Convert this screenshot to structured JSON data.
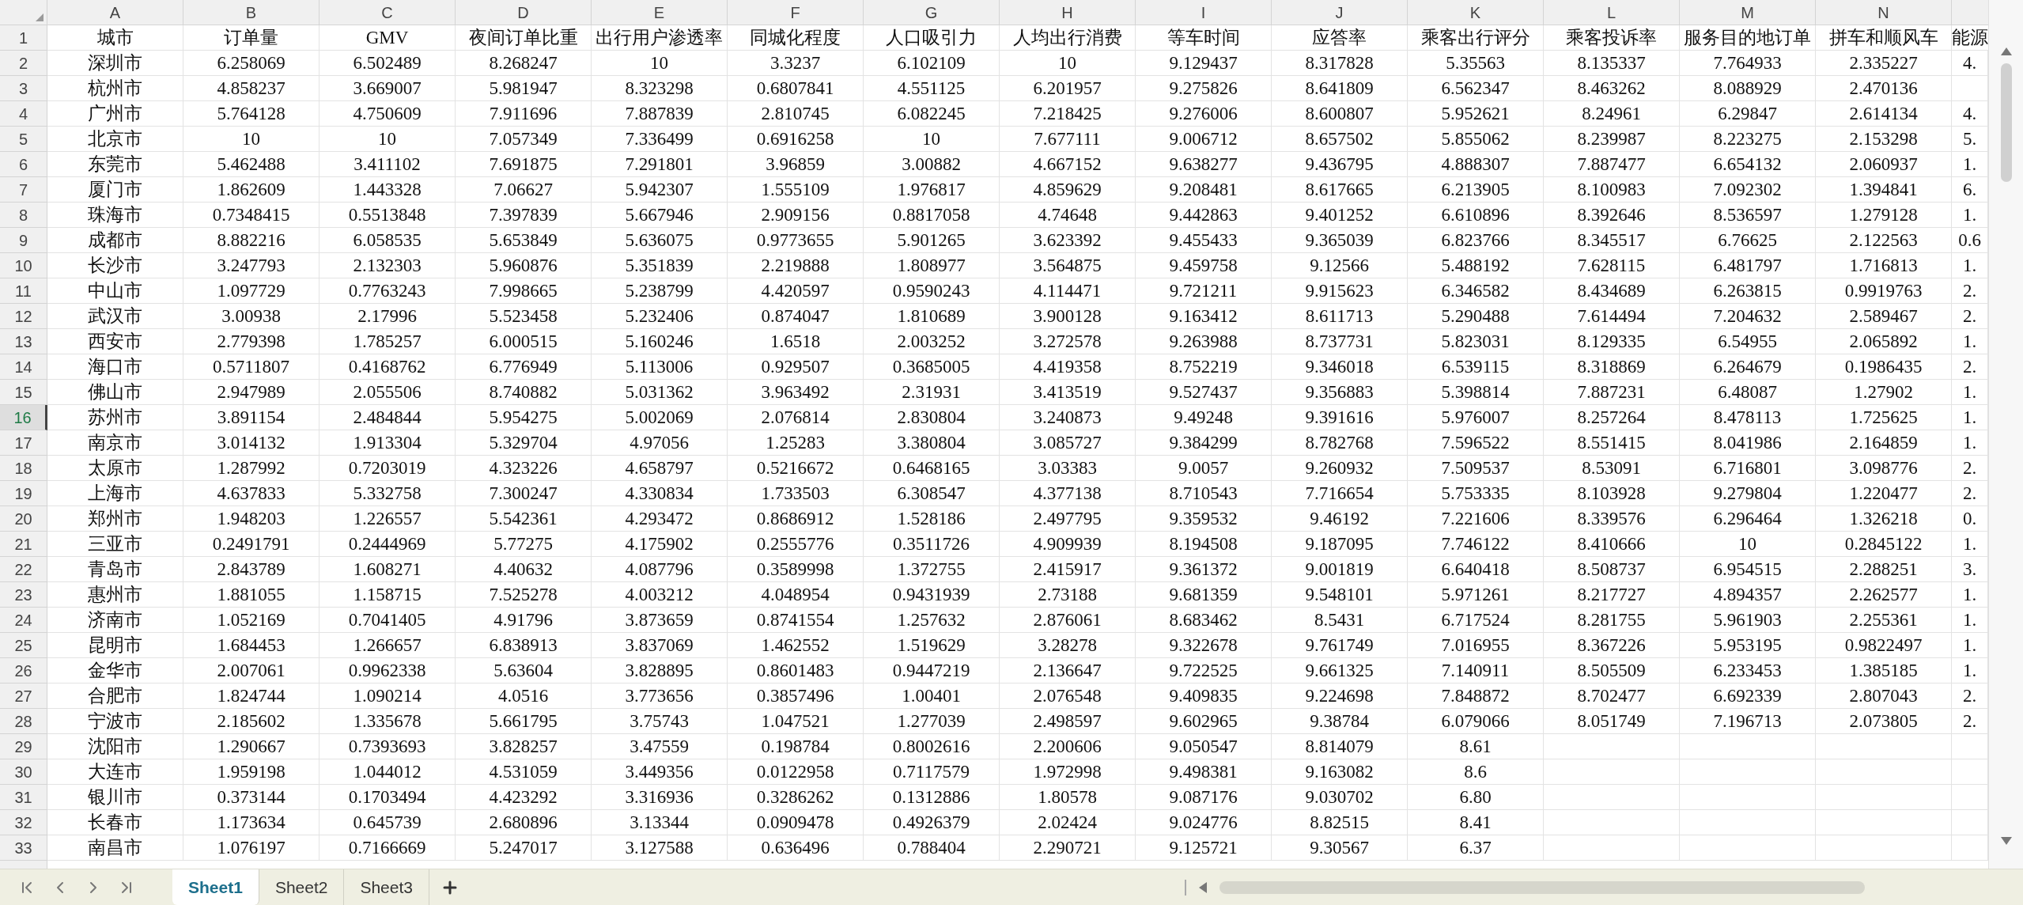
{
  "column_letters": [
    "A",
    "B",
    "C",
    "D",
    "E",
    "F",
    "G",
    "H",
    "I",
    "J",
    "K",
    "L",
    "M",
    "N"
  ],
  "rows": [
    {
      "number": "1",
      "selected": false,
      "cells": [
        "城市",
        "订单量",
        "GMV",
        "夜间订单比重",
        "出行用户渗透率",
        "同城化程度",
        "人口吸引力",
        "人均出行消费",
        "等车时间",
        "应答率",
        "乘客出行评分",
        "乘客投诉率",
        "服务目的地订单",
        "拼车和顺风车",
        "能源"
      ]
    },
    {
      "number": "2",
      "selected": false,
      "cells": [
        "深圳市",
        "6.258069",
        "6.502489",
        "8.268247",
        "10",
        "3.3237",
        "6.102109",
        "10",
        "9.129437",
        "8.317828",
        "5.35563",
        "8.135337",
        "7.764933",
        "2.335227",
        "4."
      ]
    },
    {
      "number": "3",
      "selected": false,
      "cells": [
        "杭州市",
        "4.858237",
        "3.669007",
        "5.981947",
        "8.323298",
        "0.6807841",
        "4.551125",
        "6.201957",
        "9.275826",
        "8.641809",
        "6.562347",
        "8.463262",
        "8.088929",
        "2.470136",
        null
      ]
    },
    {
      "number": "4",
      "selected": false,
      "cells": [
        "广州市",
        "5.764128",
        "4.750609",
        "7.911696",
        "7.887839",
        "2.810745",
        "6.082245",
        "7.218425",
        "9.276006",
        "8.600807",
        "5.952621",
        "8.24961",
        "6.29847",
        "2.614134",
        "4."
      ]
    },
    {
      "number": "5",
      "selected": false,
      "cells": [
        "北京市",
        "10",
        "10",
        "7.057349",
        "7.336499",
        "0.6916258",
        "10",
        "7.677111",
        "9.006712",
        "8.657502",
        "5.855062",
        "8.239987",
        "8.223275",
        "2.153298",
        "5."
      ]
    },
    {
      "number": "6",
      "selected": false,
      "cells": [
        "东莞市",
        "5.462488",
        "3.411102",
        "7.691875",
        "7.291801",
        "3.96859",
        "3.00882",
        "4.667152",
        "9.638277",
        "9.436795",
        "4.888307",
        "7.887477",
        "6.654132",
        "2.060937",
        "1."
      ]
    },
    {
      "number": "7",
      "selected": false,
      "cells": [
        "厦门市",
        "1.862609",
        "1.443328",
        "7.06627",
        "5.942307",
        "1.555109",
        "1.976817",
        "4.859629",
        "9.208481",
        "8.617665",
        "6.213905",
        "8.100983",
        "7.092302",
        "1.394841",
        "6."
      ]
    },
    {
      "number": "8",
      "selected": false,
      "cells": [
        "珠海市",
        "0.7348415",
        "0.5513848",
        "7.397839",
        "5.667946",
        "2.909156",
        "0.8817058",
        "4.74648",
        "9.442863",
        "9.401252",
        "6.610896",
        "8.392646",
        "8.536597",
        "1.279128",
        "1."
      ]
    },
    {
      "number": "9",
      "selected": false,
      "cells": [
        "成都市",
        "8.882216",
        "6.058535",
        "5.653849",
        "5.636075",
        "0.9773655",
        "5.901265",
        "3.623392",
        "9.455433",
        "9.365039",
        "6.823766",
        "8.345517",
        "6.76625",
        "2.122563",
        "0.6"
      ]
    },
    {
      "number": "10",
      "selected": false,
      "cells": [
        "长沙市",
        "3.247793",
        "2.132303",
        "5.960876",
        "5.351839",
        "2.219888",
        "1.808977",
        "3.564875",
        "9.459758",
        "9.12566",
        "5.488192",
        "7.628115",
        "6.481797",
        "1.716813",
        "1."
      ]
    },
    {
      "number": "11",
      "selected": false,
      "cells": [
        "中山市",
        "1.097729",
        "0.7763243",
        "7.998665",
        "5.238799",
        "4.420597",
        "0.9590243",
        "4.114471",
        "9.721211",
        "9.915623",
        "6.346582",
        "8.434689",
        "6.263815",
        "0.9919763",
        "2."
      ]
    },
    {
      "number": "12",
      "selected": false,
      "cells": [
        "武汉市",
        "3.00938",
        "2.17996",
        "5.523458",
        "5.232406",
        "0.874047",
        "1.810689",
        "3.900128",
        "9.163412",
        "8.611713",
        "5.290488",
        "7.614494",
        "7.204632",
        "2.589467",
        "2."
      ]
    },
    {
      "number": "13",
      "selected": false,
      "cells": [
        "西安市",
        "2.779398",
        "1.785257",
        "6.000515",
        "5.160246",
        "1.6518",
        "2.003252",
        "3.272578",
        "9.263988",
        "8.737731",
        "5.823031",
        "8.129335",
        "6.54955",
        "2.065892",
        "1."
      ]
    },
    {
      "number": "14",
      "selected": false,
      "cells": [
        "海口市",
        "0.5711807",
        "0.4168762",
        "6.776949",
        "5.113006",
        "0.929507",
        "0.3685005",
        "4.419358",
        "8.752219",
        "9.346018",
        "6.539115",
        "8.318869",
        "6.264679",
        "0.1986435",
        "2."
      ]
    },
    {
      "number": "15",
      "selected": false,
      "cells": [
        "佛山市",
        "2.947989",
        "2.055506",
        "8.740882",
        "5.031362",
        "3.963492",
        "2.31931",
        "3.413519",
        "9.527437",
        "9.356883",
        "5.398814",
        "7.887231",
        "6.48087",
        "1.27902",
        "1."
      ]
    },
    {
      "number": "16",
      "selected": true,
      "cells": [
        "苏州市",
        "3.891154",
        "2.484844",
        "5.954275",
        "5.002069",
        "2.076814",
        "2.830804",
        "3.240873",
        "9.49248",
        "9.391616",
        "5.976007",
        "8.257264",
        "8.478113",
        "1.725625",
        "1."
      ]
    },
    {
      "number": "17",
      "selected": false,
      "cells": [
        "南京市",
        "3.014132",
        "1.913304",
        "5.329704",
        "4.97056",
        "1.25283",
        "3.380804",
        "3.085727",
        "9.384299",
        "8.782768",
        "7.596522",
        "8.551415",
        "8.041986",
        "2.164859",
        "1."
      ]
    },
    {
      "number": "18",
      "selected": false,
      "cells": [
        "太原市",
        "1.287992",
        "0.7203019",
        "4.323226",
        "4.658797",
        "0.5216672",
        "0.6468165",
        "3.03383",
        "9.0057",
        "9.260932",
        "7.509537",
        "8.53091",
        "6.716801",
        "3.098776",
        "2."
      ]
    },
    {
      "number": "19",
      "selected": false,
      "cells": [
        "上海市",
        "4.637833",
        "5.332758",
        "7.300247",
        "4.330834",
        "1.733503",
        "6.308547",
        "4.377138",
        "8.710543",
        "7.716654",
        "5.753335",
        "8.103928",
        "9.279804",
        "1.220477",
        "2."
      ]
    },
    {
      "number": "20",
      "selected": false,
      "cells": [
        "郑州市",
        "1.948203",
        "1.226557",
        "5.542361",
        "4.293472",
        "0.8686912",
        "1.528186",
        "2.497795",
        "9.359532",
        "9.46192",
        "7.221606",
        "8.339576",
        "6.296464",
        "1.326218",
        "0."
      ]
    },
    {
      "number": "21",
      "selected": false,
      "cells": [
        "三亚市",
        "0.2491791",
        "0.2444969",
        "5.77275",
        "4.175902",
        "0.2555776",
        "0.3511726",
        "4.909939",
        "8.194508",
        "9.187095",
        "7.746122",
        "8.410666",
        "10",
        "0.2845122",
        "1."
      ]
    },
    {
      "number": "22",
      "selected": false,
      "cells": [
        "青岛市",
        "2.843789",
        "1.608271",
        "4.40632",
        "4.087796",
        "0.3589998",
        "1.372755",
        "2.415917",
        "9.361372",
        "9.001819",
        "6.640418",
        "8.508737",
        "6.954515",
        "2.288251",
        "3."
      ]
    },
    {
      "number": "23",
      "selected": false,
      "cells": [
        "惠州市",
        "1.881055",
        "1.158715",
        "7.525278",
        "4.003212",
        "4.048954",
        "0.9431939",
        "2.73188",
        "9.681359",
        "9.548101",
        "5.971261",
        "8.217727",
        "4.894357",
        "2.262577",
        "1."
      ]
    },
    {
      "number": "24",
      "selected": false,
      "cells": [
        "济南市",
        "1.052169",
        "0.7041405",
        "4.91796",
        "3.873659",
        "0.8741554",
        "1.257632",
        "2.876061",
        "8.683462",
        "8.5431",
        "6.717524",
        "8.281755",
        "5.961903",
        "2.255361",
        "1."
      ]
    },
    {
      "number": "25",
      "selected": false,
      "cells": [
        "昆明市",
        "1.684453",
        "1.266657",
        "6.838913",
        "3.837069",
        "1.462552",
        "1.519629",
        "3.28278",
        "9.322678",
        "9.761749",
        "7.016955",
        "8.367226",
        "5.953195",
        "0.9822497",
        "1."
      ]
    },
    {
      "number": "26",
      "selected": false,
      "cells": [
        "金华市",
        "2.007061",
        "0.9962338",
        "5.63604",
        "3.828895",
        "0.8601483",
        "0.9447219",
        "2.136647",
        "9.722525",
        "9.661325",
        "7.140911",
        "8.505509",
        "6.233453",
        "1.385185",
        "1."
      ]
    },
    {
      "number": "27",
      "selected": false,
      "cells": [
        "合肥市",
        "1.824744",
        "1.090214",
        "4.0516",
        "3.773656",
        "0.3857496",
        "1.00401",
        "2.076548",
        "9.409835",
        "9.224698",
        "7.848872",
        "8.702477",
        "6.692339",
        "2.807043",
        "2."
      ]
    },
    {
      "number": "28",
      "selected": false,
      "cells": [
        "宁波市",
        "2.185602",
        "1.335678",
        "5.661795",
        "3.75743",
        "1.047521",
        "1.277039",
        "2.498597",
        "9.602965",
        "9.38784",
        "6.079066",
        "8.051749",
        "7.196713",
        "2.073805",
        "2."
      ]
    },
    {
      "number": "29",
      "selected": false,
      "cells": [
        "沈阳市",
        "1.290667",
        "0.7393693",
        "3.828257",
        "3.47559",
        "0.198784",
        "0.8002616",
        "2.200606",
        "9.050547",
        "8.814079",
        "8.61",
        null,
        null,
        null,
        null
      ]
    },
    {
      "number": "30",
      "selected": false,
      "cells": [
        "大连市",
        "1.959198",
        "1.044012",
        "4.531059",
        "3.449356",
        "0.0122958",
        "0.7117579",
        "1.972998",
        "9.498381",
        "9.163082",
        "8.6",
        null,
        null,
        null,
        null
      ]
    },
    {
      "number": "31",
      "selected": false,
      "cells": [
        "银川市",
        "0.373144",
        "0.1703494",
        "4.423292",
        "3.316936",
        "0.3286262",
        "0.1312886",
        "1.80578",
        "9.087176",
        "9.030702",
        "6.80",
        null,
        null,
        null,
        null
      ]
    },
    {
      "number": "32",
      "selected": false,
      "cells": [
        "长春市",
        "1.173634",
        "0.645739",
        "2.680896",
        "3.13344",
        "0.0909478",
        "0.4926379",
        "2.02424",
        "9.024776",
        "8.82515",
        "8.41",
        null,
        null,
        null,
        null
      ]
    },
    {
      "number": "33",
      "selected": false,
      "cells": [
        "南昌市",
        "1.076197",
        "0.7166669",
        "5.247017",
        "3.127588",
        "0.636496",
        "0.788404",
        "2.290721",
        "9.125721",
        "9.30567",
        "6.37",
        null,
        null,
        null,
        null
      ]
    }
  ],
  "sheet_tabs": [
    {
      "label": "Sheet1",
      "selected": true
    },
    {
      "label": "Sheet2",
      "selected": false
    },
    {
      "label": "Sheet3",
      "selected": false
    }
  ]
}
